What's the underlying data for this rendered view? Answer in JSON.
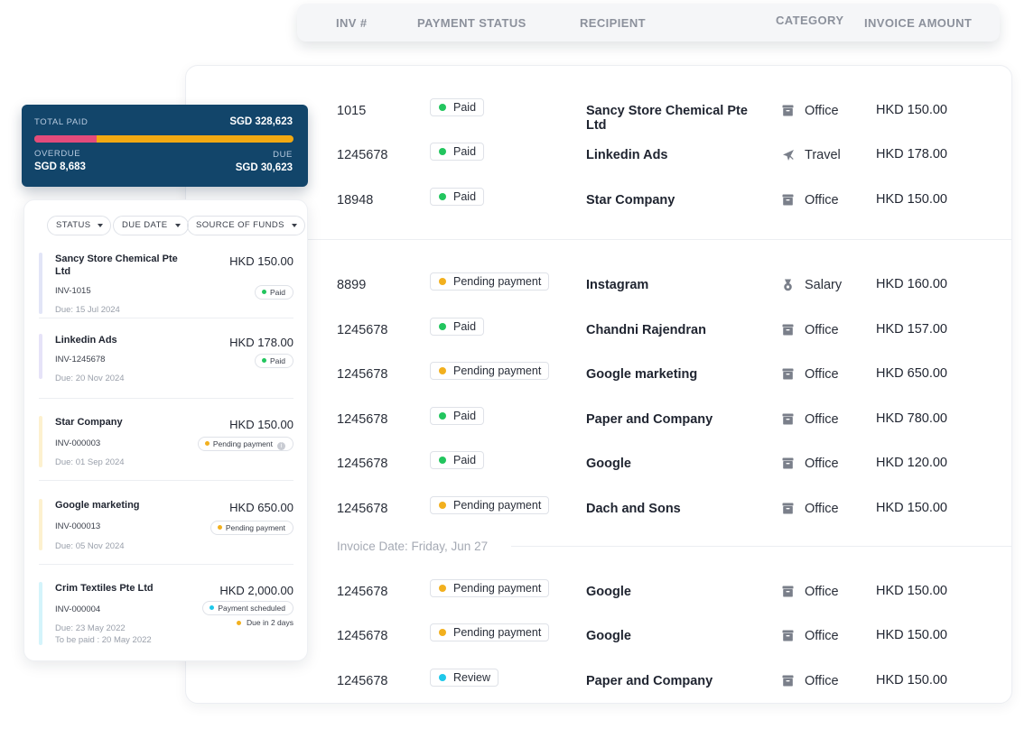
{
  "colors": {
    "paid": "#22c55e",
    "pending": "#f2b01e",
    "review": "#1ec8ea",
    "summary_bg": "#12456a",
    "overdue_bar": "#e34b7b",
    "due_bar": "#f2a912"
  },
  "table": {
    "headers": {
      "inv": "INV #",
      "status": "PAYMENT STATUS",
      "recipient": "RECIPIENT",
      "category": "CATEGORY",
      "amount": "INVOICE AMOUNT"
    },
    "date_separator": "Invoice Date: Friday, Jun 27",
    "rows": [
      {
        "inv": "1015",
        "status": "Paid",
        "status_key": "paid",
        "recipient": "Sancy Store Chemical Pte Ltd",
        "category": "Office",
        "category_icon": "office-icon",
        "amount": "HKD 150.00"
      },
      {
        "inv": "1245678",
        "status": "Paid",
        "status_key": "paid",
        "recipient": "Linkedin Ads",
        "category": "Travel",
        "category_icon": "airplane-icon",
        "amount": "HKD 178.00"
      },
      {
        "inv": "18948",
        "status": "Paid",
        "status_key": "paid",
        "recipient": "Star Company",
        "category": "Office",
        "category_icon": "office-icon",
        "amount": "HKD 150.00"
      },
      {
        "inv": "8899",
        "status": "Pending payment",
        "status_key": "pending",
        "recipient": "Instagram",
        "category": "Salary",
        "category_icon": "medal-icon",
        "amount": "HKD 160.00"
      },
      {
        "inv": "1245678",
        "status": "Paid",
        "status_key": "paid",
        "recipient": "Chandni Rajendran",
        "category": "Office",
        "category_icon": "office-icon",
        "amount": "HKD 157.00"
      },
      {
        "inv": "1245678",
        "status": "Pending payment",
        "status_key": "pending",
        "recipient": "Google marketing",
        "category": "Office",
        "category_icon": "office-icon",
        "amount": "HKD 650.00"
      },
      {
        "inv": "1245678",
        "status": "Paid",
        "status_key": "paid",
        "recipient": "Paper and Company",
        "category": "Office",
        "category_icon": "office-icon",
        "amount": "HKD 780.00"
      },
      {
        "inv": "1245678",
        "status": "Paid",
        "status_key": "paid",
        "recipient": "Google",
        "category": "Office",
        "category_icon": "office-icon",
        "amount": "HKD 120.00"
      },
      {
        "inv": "1245678",
        "status": "Pending payment",
        "status_key": "pending",
        "recipient": "Dach and Sons",
        "category": "Office",
        "category_icon": "office-icon",
        "amount": "HKD 150.00"
      },
      {
        "inv": "1245678",
        "status": "Pending payment",
        "status_key": "pending",
        "recipient": "Google",
        "category": "Office",
        "category_icon": "office-icon",
        "amount": "HKD 150.00"
      },
      {
        "inv": "1245678",
        "status": "Pending payment",
        "status_key": "pending",
        "recipient": "Google",
        "category": "Office",
        "category_icon": "office-icon",
        "amount": "HKD 150.00"
      },
      {
        "inv": "1245678",
        "status": "Review",
        "status_key": "review",
        "recipient": "Paper and Company",
        "category": "Office",
        "category_icon": "office-icon",
        "amount": "HKD 150.00"
      }
    ]
  },
  "summary": {
    "total_paid_label": "TOTAL PAID",
    "total_paid_value": "SGD 328,623",
    "overdue_label": "OVERDUE",
    "overdue_value": "SGD 8,683",
    "due_label": "DUE",
    "due_value": "SGD 30,623",
    "overdue_fraction": 0.24
  },
  "mobile": {
    "filters": [
      "STATUS",
      "DUE DATE",
      "SOURCE OF FUNDS"
    ],
    "items": [
      {
        "name": "Sancy Store Chemical Pte Ltd",
        "amount": "HKD 150.00",
        "inv": "INV-1015",
        "status": "Paid",
        "status_key": "paid",
        "due": "Due: 15 Jul  2024",
        "accent": "#e2e5f7"
      },
      {
        "name": "Linkedin Ads",
        "amount": "HKD 178.00",
        "inv": "INV-1245678",
        "status": "Paid",
        "status_key": "paid",
        "due": "Due: 20 Nov 2024",
        "accent": "#e6e3f8"
      },
      {
        "name": "Star Company",
        "amount": "HKD 150.00",
        "inv": "INV-000003",
        "status": "Pending payment",
        "status_key": "pending",
        "due": "Due: 01 Sep 2024",
        "accent": "#fdf1cf"
      },
      {
        "name": "Google marketing",
        "amount": "HKD 650.00",
        "inv": "INV-000013",
        "status": "Pending payment",
        "status_key": "pending",
        "due": "Due: 05 Nov 2024",
        "accent": "#fdf1cf"
      },
      {
        "name": "Crim Textiles Pte Ltd",
        "amount": "HKD 2,000.00",
        "inv": "INV-000004",
        "status": "Payment scheduled",
        "status_key": "review",
        "due": "Due: 23 May 2022",
        "due2": "To be paid : 20 May 2022",
        "note": "Due in 2 days",
        "accent": "#d4f4fb"
      }
    ]
  }
}
